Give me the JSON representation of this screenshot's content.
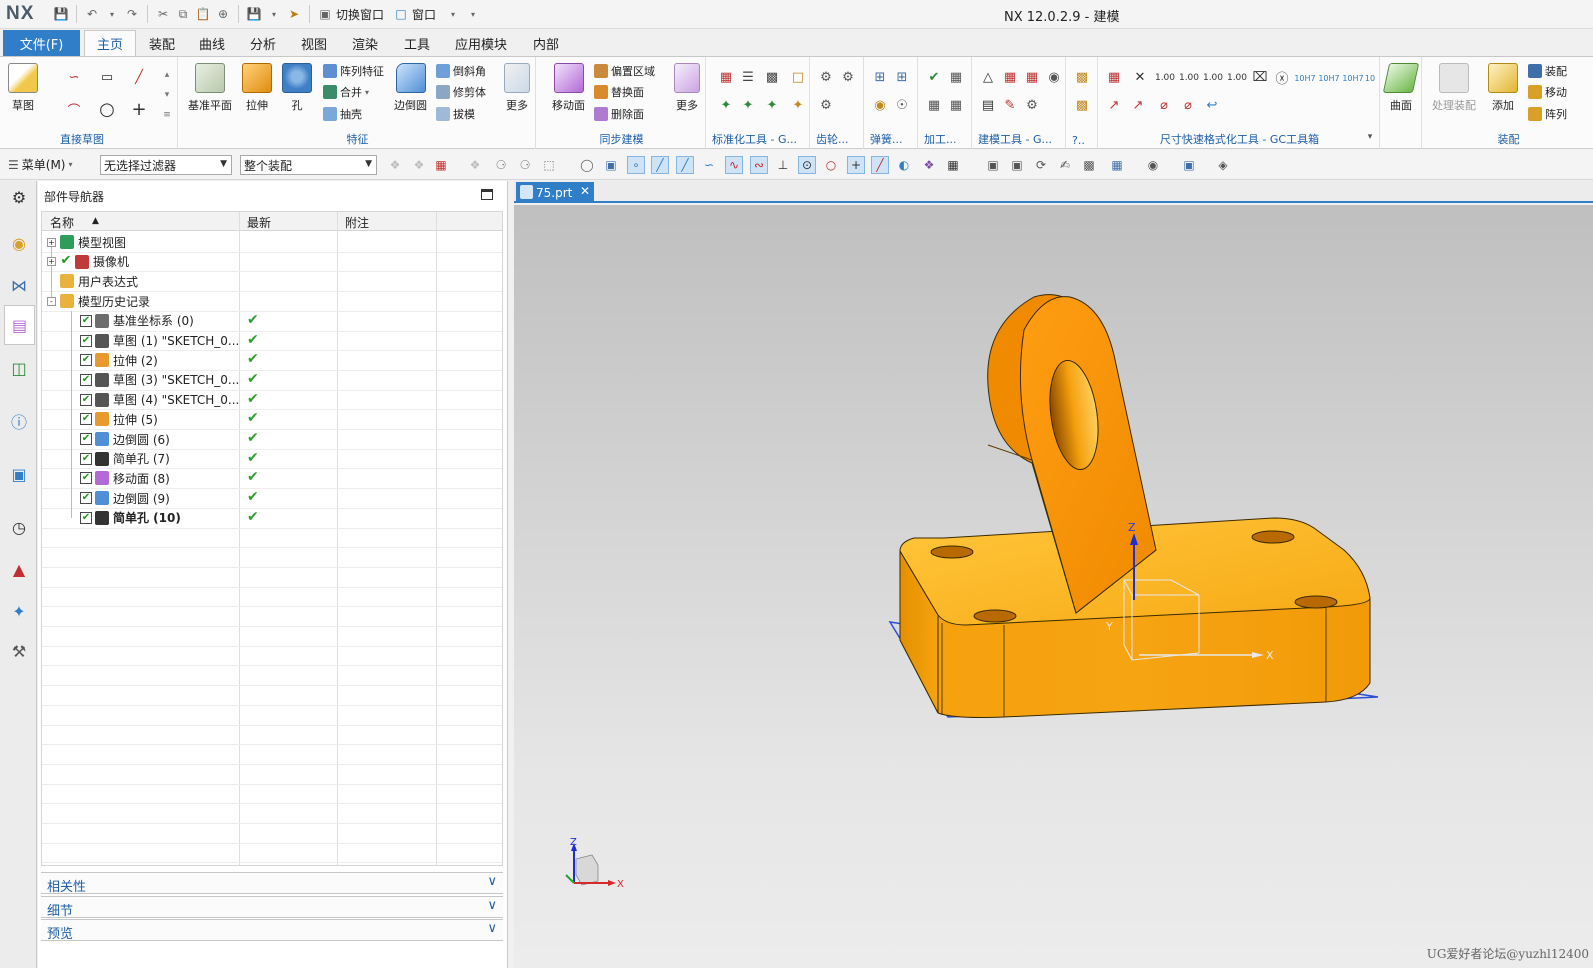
{
  "app": {
    "logo": "NX",
    "window_title": "NX 12.0.2.9 - 建模",
    "quick_access": {
      "switch_window": "切换窗口",
      "window_menu": "窗口"
    }
  },
  "ribbon_tabs": [
    "文件(F)",
    "主页",
    "装配",
    "曲线",
    "分析",
    "视图",
    "渲染",
    "工具",
    "应用模块",
    "内部"
  ],
  "active_tab": "主页",
  "ribbon": {
    "sketch_group": {
      "label": "直接草图",
      "sketch_btn": "草图"
    },
    "feature_group": {
      "label": "特征",
      "datum_plane": "基准平面",
      "extrude": "拉伸",
      "hole": "孔",
      "pattern_feature": "阵列特征",
      "unite": "合并",
      "shell": "抽壳",
      "edge_blend": "边倒圆",
      "chamfer": "倒斜角",
      "trim_body": "修剪体",
      "draft": "拔模",
      "more": "更多"
    },
    "sync_group": {
      "label": "同步建模",
      "move_face": "移动面",
      "offset_region": "偏置区域",
      "replace_face": "替换面",
      "delete_face": "删除面",
      "more": "更多"
    },
    "std_tools_label": "标准化工具 - G...",
    "gear_label": "齿轮...",
    "spring_label": "弹簧...",
    "machining_label": "加工...",
    "modeling_tools_label": "建模工具 - G...",
    "more_label": "?..",
    "dim_tools_label": "尺寸快速格式化工具 - GC工具箱",
    "tol_labels": [
      "1.00",
      "1.00",
      "1.00",
      "1.00"
    ],
    "fit_labels": [
      "10H7",
      "10H7",
      "10H7",
      "10"
    ],
    "surface_btn": "曲面",
    "assembly_group": {
      "label": "装配",
      "process_assembly": "处理装配",
      "add": "添加",
      "assembly": "装配",
      "move": "移动",
      "pattern": "阵列"
    }
  },
  "selection_bar": {
    "menu": "菜单(M)",
    "filter": "无选择过滤器",
    "scope": "整个装配"
  },
  "navigator": {
    "title": "部件导航器",
    "columns": [
      "名称",
      "最新",
      "附注"
    ],
    "rows": [
      {
        "label": "模型视图",
        "level": 0,
        "expander": "+",
        "check": false,
        "icon": "model-views-icon",
        "color": "#2e9c5a",
        "latest": false,
        "bold": false
      },
      {
        "label": "摄像机",
        "level": 0,
        "expander": "+",
        "check": true,
        "icon": "camera-icon",
        "color": "#c03a3a",
        "latest": false,
        "bold": false
      },
      {
        "label": "用户表达式",
        "level": 0,
        "expander": "",
        "check": false,
        "icon": "folder-icon",
        "color": "#e8b23c",
        "latest": false,
        "bold": false
      },
      {
        "label": "模型历史记录",
        "level": 0,
        "expander": "-",
        "check": false,
        "icon": "folder-icon",
        "color": "#e8b23c",
        "latest": false,
        "bold": false
      },
      {
        "label": "基准坐标系 (0)",
        "level": 1,
        "expander": "",
        "check": true,
        "icon": "datum-csys-icon",
        "color": "#6d6d6d",
        "latest": true,
        "bold": false
      },
      {
        "label": "草图 (1) \"SKETCH_0...",
        "level": 1,
        "expander": "",
        "check": true,
        "icon": "sketch-icon",
        "color": "#555555",
        "latest": true,
        "bold": false
      },
      {
        "label": "拉伸 (2)",
        "level": 1,
        "expander": "",
        "check": true,
        "icon": "extrude-icon",
        "color": "#e89b2c",
        "latest": true,
        "bold": false
      },
      {
        "label": "草图 (3) \"SKETCH_0...",
        "level": 1,
        "expander": "",
        "check": true,
        "icon": "sketch-icon",
        "color": "#555555",
        "latest": true,
        "bold": false
      },
      {
        "label": "草图 (4) \"SKETCH_0...",
        "level": 1,
        "expander": "",
        "check": true,
        "icon": "sketch-icon",
        "color": "#555555",
        "latest": true,
        "bold": false
      },
      {
        "label": "拉伸 (5)",
        "level": 1,
        "expander": "",
        "check": true,
        "icon": "extrude-icon",
        "color": "#e89b2c",
        "latest": true,
        "bold": false
      },
      {
        "label": "边倒圆 (6)",
        "level": 1,
        "expander": "",
        "check": true,
        "icon": "edge-blend-icon",
        "color": "#4f8fd6",
        "latest": true,
        "bold": false
      },
      {
        "label": "简单孔 (7)",
        "level": 1,
        "expander": "",
        "check": true,
        "icon": "simple-hole-icon",
        "color": "#333333",
        "latest": true,
        "bold": false
      },
      {
        "label": "移动面 (8)",
        "level": 1,
        "expander": "",
        "check": true,
        "icon": "move-face-icon",
        "color": "#b36ad6",
        "latest": true,
        "bold": false
      },
      {
        "label": "边倒圆 (9)",
        "level": 1,
        "expander": "",
        "check": true,
        "icon": "edge-blend-icon",
        "color": "#4f8fd6",
        "latest": true,
        "bold": false
      },
      {
        "label": "简单孔 (10)",
        "level": 1,
        "expander": "",
        "check": true,
        "icon": "simple-hole-icon",
        "color": "#333333",
        "latest": true,
        "bold": true
      }
    ],
    "panels": [
      "相关性",
      "细节",
      "预览"
    ]
  },
  "graphics": {
    "tab": "75.prt",
    "axis_labels": {
      "z": "Z",
      "x": "X",
      "y": "Y"
    },
    "watermark": "UG爱好者论坛@yuzhl12400"
  },
  "colors": {
    "accent": "#2f7ec7",
    "part": "#f5a00d",
    "part_light": "#ffbf2b",
    "part_dark": "#d98400",
    "check": "#2ca02c"
  }
}
